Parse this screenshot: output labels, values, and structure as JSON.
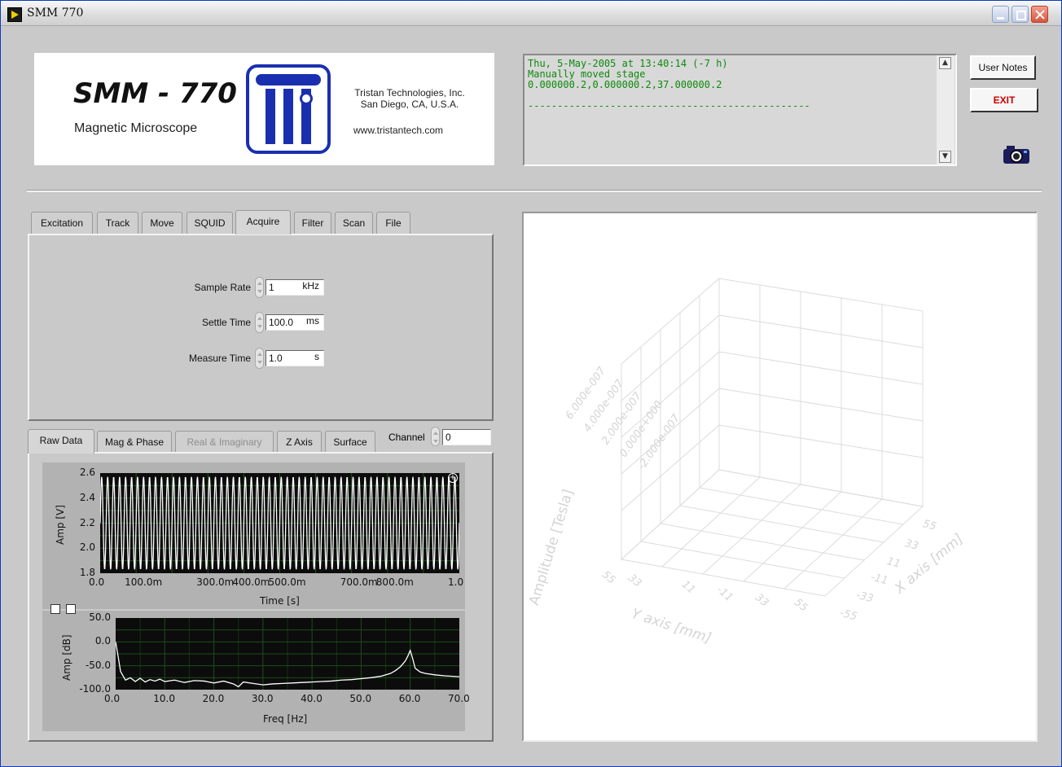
{
  "window": {
    "title": "SMM 770"
  },
  "logo": {
    "title": "SMM - 770",
    "subtitle": "Magnetic Microscope",
    "company_line1": "Tristan Technologies, Inc.",
    "company_line2": "San Diego, CA, U.S.A.",
    "website": "www.tristantech.com"
  },
  "log": {
    "lines": [
      "Thu, 5-May-2005 at 13:40:14 (-7 h)",
      "Manually moved stage",
      "0.000000.2,0.000000.2,37.000000.2",
      "",
      "------------------------------------------------"
    ]
  },
  "buttons": {
    "user_notes": "User Notes",
    "exit": "EXIT"
  },
  "top_tabs": [
    "Excitation",
    "Track",
    "Move",
    "SQUID",
    "Acquire",
    "Filter",
    "Scan",
    "File"
  ],
  "top_tabs_active": "Acquire",
  "acquire": {
    "sample_rate": {
      "label": "Sample Rate",
      "value": "1",
      "unit": "kHz"
    },
    "settle_time": {
      "label": "Settle Time",
      "value": "100.0",
      "unit": "ms"
    },
    "measure_time": {
      "label": "Measure Time",
      "value": "1.0",
      "unit": "s"
    }
  },
  "bottom_tabs": [
    "Raw Data",
    "Mag & Phase",
    "Real & Imaginary",
    "Z Axis",
    "Surface"
  ],
  "bottom_tabs_active": "Raw Data",
  "bottom_tabs_disabled": "Real & Imaginary",
  "channel": {
    "label": "Channel",
    "value": "0"
  },
  "chart_data": [
    {
      "type": "line",
      "title": "",
      "xlabel": "Time [s]",
      "ylabel": "Amp [V]",
      "xlim": [
        0,
        1
      ],
      "ylim": [
        1.8,
        2.6
      ],
      "x_tick_labels": [
        "0.0",
        "100.0m",
        "300.0m",
        "400.0m",
        "500.0m",
        "700.0m",
        "800.0m",
        "1.0"
      ],
      "x_tick_values": [
        0,
        0.1,
        0.3,
        0.4,
        0.5,
        0.7,
        0.8,
        1.0
      ],
      "y_tick_labels": [
        "2.6",
        "2.4",
        "2.2",
        "2.0",
        "1.8"
      ],
      "y_tick_values": [
        2.6,
        2.4,
        2.2,
        2.0,
        1.8
      ],
      "series": [
        {
          "signal": "sine",
          "frequency_hz": 60,
          "offset": 2.2,
          "amplitude": 0.37,
          "color": "#ffffff"
        }
      ],
      "grid": true
    },
    {
      "type": "line",
      "title": "",
      "xlabel": "Freq [Hz]",
      "ylabel": "Amp [dB]",
      "xlim": [
        0,
        70
      ],
      "ylim": [
        -100,
        50
      ],
      "x_tick_labels": [
        "0.0",
        "10.0",
        "20.0",
        "30.0",
        "40.0",
        "50.0",
        "60.0",
        "70.0"
      ],
      "x_tick_values": [
        0,
        10,
        20,
        30,
        40,
        50,
        60,
        70
      ],
      "y_tick_labels": [
        "50.0",
        "0.0",
        "-50.0",
        "-100.0"
      ],
      "y_tick_values": [
        50,
        0,
        -50,
        -100
      ],
      "series": [
        {
          "color": "#ffffff",
          "x": [
            0,
            0.5,
            1,
            2,
            3,
            4,
            5,
            6,
            7,
            8,
            9,
            10,
            12,
            14,
            16,
            18,
            20,
            22,
            24,
            25,
            26,
            28,
            30,
            32,
            34,
            36,
            38,
            40,
            42,
            44,
            46,
            48,
            50,
            52,
            54,
            56,
            57,
            58,
            59,
            59.5,
            60,
            60.5,
            61,
            62,
            63,
            65,
            67,
            70
          ],
          "y": [
            0,
            -30,
            -62,
            -80,
            -75,
            -83,
            -76,
            -84,
            -79,
            -82,
            -78,
            -83,
            -80,
            -85,
            -81,
            -82,
            -86,
            -82,
            -88,
            -94,
            -84,
            -87,
            -90,
            -88,
            -87,
            -86,
            -85,
            -84,
            -83,
            -82,
            -80,
            -79,
            -77,
            -75,
            -72,
            -66,
            -60,
            -52,
            -40,
            -30,
            -18,
            -35,
            -55,
            -63,
            -66,
            -69,
            -71,
            -73
          ]
        }
      ],
      "grid": true
    }
  ],
  "graph3d": {
    "z_axis_label": "Amplitude [Tesla]",
    "z_tick_labels": [
      "6.000e-007",
      "4.000e-007",
      "2.000e-007",
      "0.000e+000",
      "-2.000e-007"
    ],
    "y_axis_label": "Y axis [mm]",
    "y_tick_labels": [
      "55",
      "33",
      "11",
      "-11",
      "33",
      "55"
    ],
    "x_axis_label": "X axis [mm]",
    "x_tick_labels": [
      "55",
      "33",
      "11",
      "-11",
      "-33",
      "-55"
    ]
  }
}
